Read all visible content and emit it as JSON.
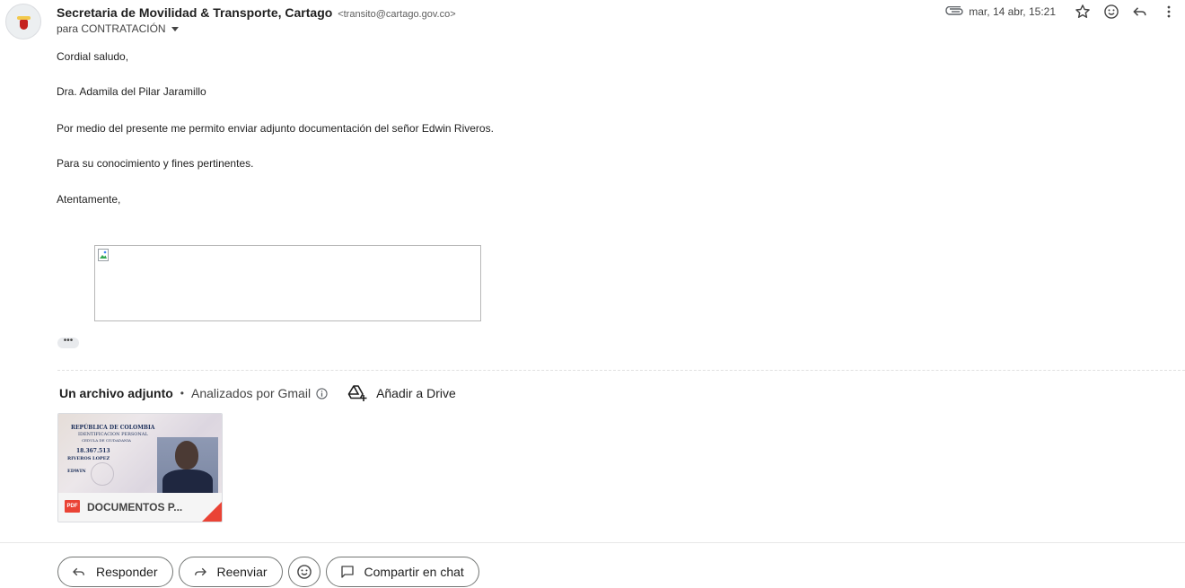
{
  "sender": {
    "name": "Secretaria de Movilidad & Transporte, Cartago",
    "email": "<transito@cartago.gov.co>",
    "recipient": "para CONTRATACIÓN"
  },
  "meta": {
    "date": "mar, 14 abr, 15:21",
    "icons": [
      "attachment-icon",
      "star-icon",
      "emoji-icon",
      "reply-icon",
      "more-vert-icon"
    ]
  },
  "body": {
    "greeting": "Cordial saludo,",
    "addressee": "Dra. Adamila del Pilar Jaramillo",
    "paragraph1": "Por medio del presente me permito enviar adjunto documentación del señor Edwin Riveros.",
    "paragraph2": "Para su conocimiento y fines pertinentes.",
    "closing": "Atentamente,"
  },
  "attachments": {
    "count_label": "Un archivo adjunto",
    "separator": "•",
    "scanned_label": "Analizados por Gmail",
    "drive_label": "Añadir a Drive",
    "file": {
      "type_badge": "PDF",
      "name": "DOCUMENTOS P...",
      "preview": {
        "line1": "REPÚBLICA DE COLOMBIA",
        "line2": "IDENTIFICACION PERSONAL",
        "line3": "CEDULA DE CIUDADANIA",
        "number": "18.367.513",
        "surname": "RIVEROS LOPEZ",
        "given_name": "EDWIN"
      }
    }
  },
  "actions": {
    "reply": "Responder",
    "forward": "Reenviar",
    "share_chat": "Compartir en chat"
  }
}
